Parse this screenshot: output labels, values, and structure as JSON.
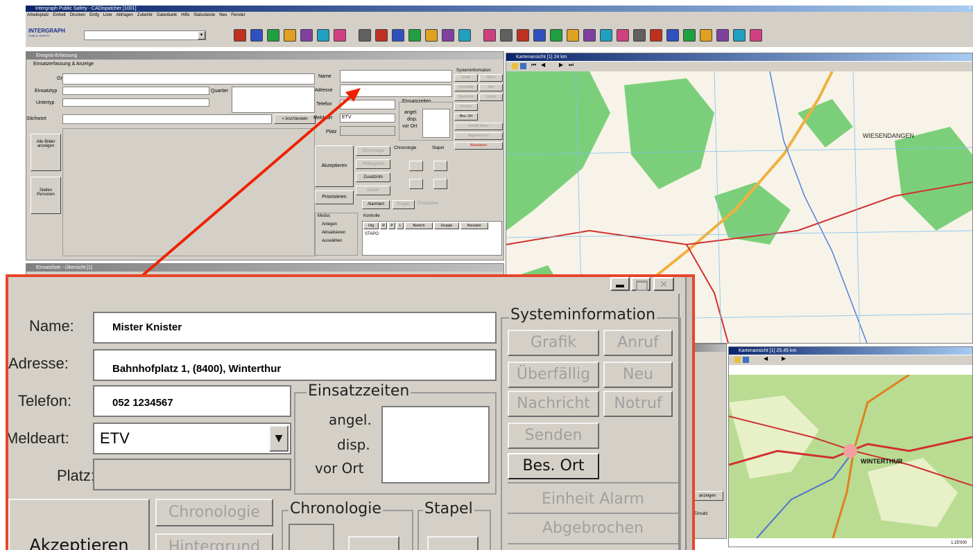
{
  "app": {
    "title": "Intergraph Public Safety - CADispatcher [1001]",
    "menu": [
      "Arbeitsplatz",
      "Einheit",
      "Drucken",
      "Einfg",
      "Liste",
      "Abfragen",
      "Zubehör",
      "Datenbank",
      "Hilfe",
      "Statusleiste",
      "Neu",
      "Fenster"
    ],
    "logo_text": "INTERGRAPH",
    "logo_sub": "PUBLIC SAFETY",
    "toolbar_icons": [
      "ve-icon",
      "list-icon",
      "person-icon",
      "phone-icon",
      "book-icon",
      "map-icon",
      "help-icon",
      "eis-icon",
      "stab-icon",
      "mail-icon",
      "grid-icon",
      "route-icon",
      "run-icon",
      "select-icon",
      "zoom-in-icon",
      "zoom-out-icon",
      "globe-icon",
      "monitor-icon",
      "monitor2-icon",
      "measure-icon",
      "draw-icon",
      "pin-icon",
      "pin2-icon",
      "lage-icon",
      "lage2-icon",
      "boat-icon",
      "building-icon",
      "building2-icon",
      "tree-icon",
      "walk-icon",
      "walk2-icon"
    ]
  },
  "incident_window": {
    "title": "Ereignis-Erfassung",
    "section": "Einsatzerfassung & Anzeige",
    "labels": {
      "ort": "Ort",
      "einsatztyp": "Einsatztyp",
      "untertyp": "Untertyp",
      "stichwort": "Stichwort",
      "quartier": "Quartier",
      "name": "Name",
      "adresse": "Adresse",
      "telefon": "Telefon",
      "meldeart": "Meldeart",
      "platz": "Platz"
    },
    "meldeart_value": "ETV",
    "anzeigen_button": "< Anz/Verdeln",
    "side_buttons": [
      "Alle Bilder anzeigen",
      "Stellen Personen"
    ],
    "einsatzzeiten": {
      "title": "Einsatzzeiten",
      "rows": [
        "angel.",
        "disp.",
        "vor Ort"
      ]
    },
    "sysinfo_title": "Systeminformation",
    "sysinfo_buttons": [
      "Grafik",
      "Anruf",
      "Überfällig",
      "Neu",
      "Nachricht",
      "Notruf",
      "Senden",
      "Bes. Ort",
      "Einheit Alarm",
      "Abgebrochen",
      "Aktualisiert"
    ],
    "buttons": {
      "akzeptieren": "Akzeptieren",
      "chronologie": "Chronologie",
      "hintergrund": "Hintergrund",
      "zusatzinfo": "Zusatzinfo",
      "gefahr": "Gefahr",
      "stapel": "Stapel",
      "priorisieren": "Priorisieren",
      "alarmiert": "Alarmiert",
      "fragen": "Fragen",
      "einsatzliste": "Einsatzliste"
    },
    "modus": {
      "title": "Modus",
      "options": [
        "Anlegen",
        "Aktualisieren",
        "Auswählen"
      ]
    },
    "kontrolle": {
      "title": "Kontrolle",
      "headers": [
        "Org",
        "R",
        "P",
        "L",
        "Bereich",
        "Gruppe",
        "Benutzer"
      ],
      "row": "STAPO"
    }
  },
  "map_window": {
    "title": "Kartenansicht [1] 24 km",
    "place": "WIESENDANGEN"
  },
  "map_window2": {
    "title": "Kartenansicht [1] 25.45 km",
    "place": "WINTERTHUR",
    "scale": "1:25'000"
  },
  "lower_window": {
    "title": "Einsatzliste - Übersicht [1]"
  },
  "right_mid": {
    "btn1": "anzeigen",
    "btn2": "Einsatz"
  },
  "zoom": {
    "labels": {
      "name": "Name:",
      "adresse": "Adresse:",
      "telefon": "Telefon:",
      "meldeart": "Meldeart:",
      "platz": "Platz:"
    },
    "values": {
      "name": "Mister Knister",
      "adresse": "Bahnhofplatz 1, (8400), Winterthur",
      "telefon": "052 1234567",
      "meldeart": "ETV"
    },
    "einsatzzeiten": {
      "title": "Einsatzzeiten",
      "angel": "angel.",
      "disp": "disp.",
      "vor_ort": "vor Ort"
    },
    "sysinfo_title": "Systeminformation",
    "buttons": {
      "grafik": "Grafik",
      "anruf": "Anruf",
      "ueberfaellig": "Überfällig",
      "neu": "Neu",
      "nachricht": "Nachricht",
      "notruf": "Notruf",
      "senden": "Senden",
      "bes_ort": "Bes. Ort",
      "einheit_alarm": "Einheit Alarm",
      "abgebrochen": "Abgebrochen",
      "akzeptieren": "Akzeptieren",
      "chronologie": "Chronologie",
      "hintergrund": "Hintergrund"
    },
    "groups": {
      "chronologie": "Chronologie",
      "stapel": "Stapel"
    }
  },
  "colors": {
    "highlight": "#e8452a",
    "arrow": "#ee2200",
    "title_active": "#0a246a",
    "face": "#d4d0c8",
    "forest": "#7ccf7a"
  }
}
